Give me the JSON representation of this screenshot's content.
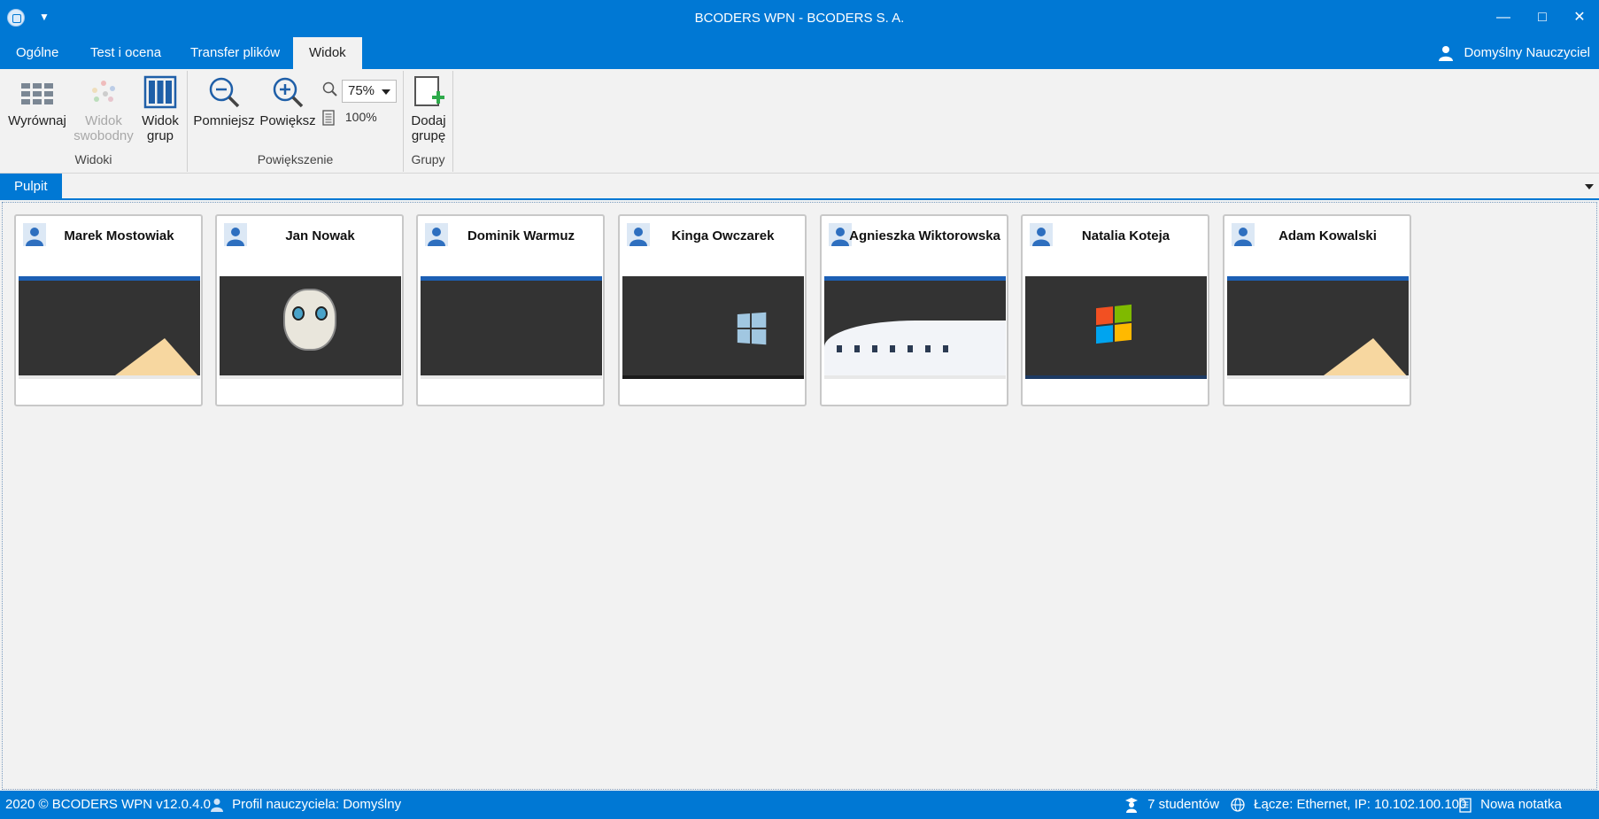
{
  "window": {
    "title": "BCODERS WPN - BCODERS S. A.",
    "minimize_glyph": "—",
    "maximize_glyph": "□",
    "close_glyph": "✕",
    "quick_access_glyph": "▼"
  },
  "menu": {
    "tabs": [
      "Ogólne",
      "Test i ocena",
      "Transfer plików",
      "Widok"
    ],
    "active": "Widok",
    "user": "Domyślny Nauczyciel"
  },
  "ribbon": {
    "groups": {
      "widoki": "Widoki",
      "powiekszenie": "Powiększenie",
      "grupy": "Grupy"
    },
    "buttons": {
      "wyrownaj": "Wyrównaj",
      "widok_swobodny_1": "Widok",
      "widok_swobodny_2": "swobodny",
      "widok_grup_1": "Widok",
      "widok_grup_2": "grup",
      "pomniejsz": "Pomniejsz",
      "powieksz": "Powiększ",
      "dodaj_grupe_1": "Dodaj",
      "dodaj_grupe_2": "grupę"
    },
    "zoom": {
      "selected": "75%",
      "reset": "100%"
    }
  },
  "workspace": {
    "tab": "Pulpit"
  },
  "students": [
    {
      "name": "Marek Mostowiak",
      "screen": "win8"
    },
    {
      "name": "Jan Nowak",
      "screen": "cartoon"
    },
    {
      "name": "Dominik Warmuz",
      "screen": "field"
    },
    {
      "name": "Kinga Owczarek",
      "screen": "win10"
    },
    {
      "name": "Agnieszka Wiktorowska",
      "screen": "building"
    },
    {
      "name": "Natalia Koteja",
      "screen": "win7"
    },
    {
      "name": "Adam Kowalski",
      "screen": "win8"
    }
  ],
  "status": {
    "copyright": "2020 ©  BCODERS WPN v12.0.4.0",
    "profile": "Profil nauczyciela: Domyślny",
    "students": "7 studentów",
    "connection": "Łącze: Ethernet, IP: 10.102.100.100",
    "note": "Nowa notatka"
  },
  "colors": {
    "accent": "#0078d4",
    "background": "#f2f2f2"
  }
}
